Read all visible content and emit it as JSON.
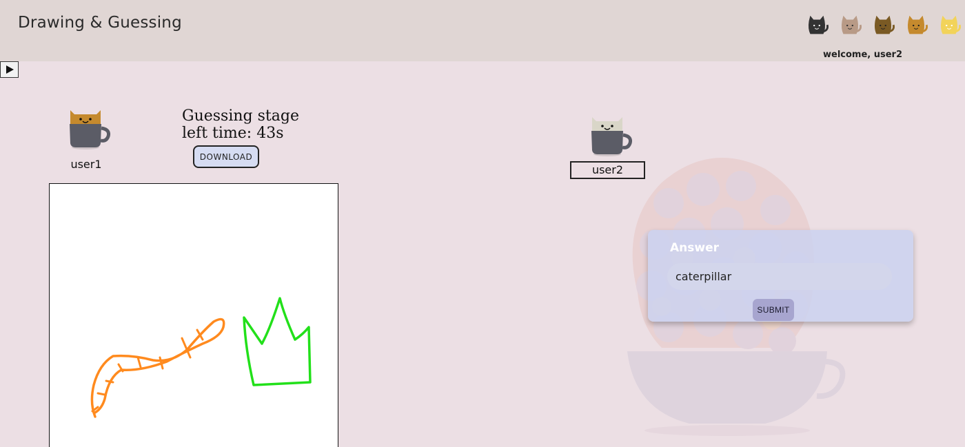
{
  "header": {
    "title": "Drawing & Guessing",
    "welcome": "welcome, user2",
    "cat_avatars": [
      {
        "icon": "black-cat-icon",
        "color": "#333333"
      },
      {
        "icon": "tan-cat-icon",
        "color": "#b89a86"
      },
      {
        "icon": "brown-cat-icon",
        "color": "#7a5a24"
      },
      {
        "icon": "orange-cat-icon",
        "color": "#c58a2e"
      },
      {
        "icon": "yellow-cat-icon",
        "color": "#f2d35a"
      }
    ]
  },
  "controls": {
    "play_icon": "play-icon"
  },
  "players": [
    {
      "name": "user1",
      "cat_color": "#c58a2e",
      "cup_color": "#5b5c66"
    },
    {
      "name": "user2",
      "cat_color": "#d9d6c8",
      "cup_color": "#5b5c66"
    }
  ],
  "game": {
    "stage": "Guessing stage",
    "time_left": "left time: 43s",
    "download_label": "DOWNLOAD"
  },
  "answer": {
    "label": "Answer",
    "value": "caterpillar",
    "submit_label": "SUBMIT"
  },
  "colors": {
    "background": "#ecdfe4",
    "header": "#e0d6d4",
    "stroke_orange": "#ff8a1e",
    "stroke_green": "#22e01a"
  }
}
